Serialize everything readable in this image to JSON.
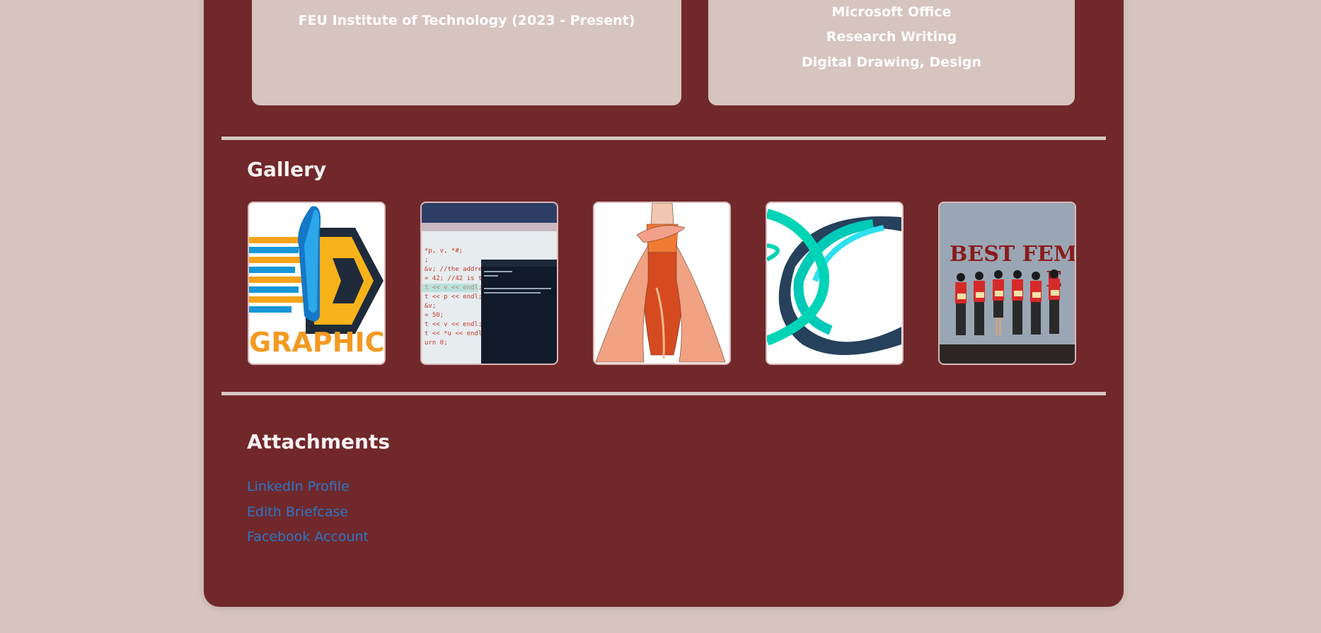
{
  "education": {
    "school": "FEU Institute of Technology (2023 - Present)"
  },
  "skills": {
    "items": [
      "Microsoft Office",
      "Research Writing",
      "Digital Drawing, Design"
    ]
  },
  "gallery": {
    "title": "Gallery",
    "images": [
      {
        "name": "graphics-logo",
        "text": "GRAPHICS"
      },
      {
        "name": "code-screenshot",
        "text": ""
      },
      {
        "name": "gown-illustration",
        "text": ""
      },
      {
        "name": "swirl-logo",
        "text": ""
      },
      {
        "name": "award-photo",
        "text": "BEST FEMA"
      }
    ]
  },
  "attachments": {
    "title": "Attachments",
    "links": [
      "LinkedIn Profile",
      "Edith Briefcase",
      "Facebook Account"
    ]
  },
  "colors": {
    "page_bg": "#d6c4bf",
    "card_bg": "#71282b",
    "link": "#2a76c8"
  }
}
